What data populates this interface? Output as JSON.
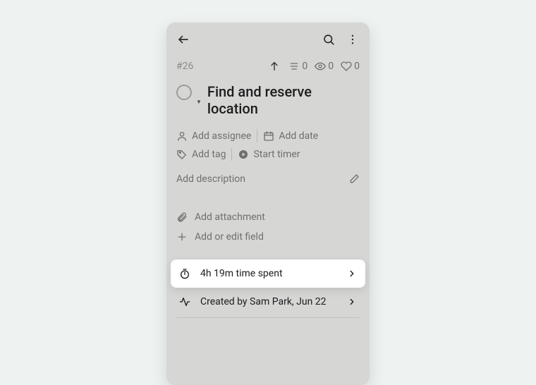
{
  "task": {
    "id": "#26",
    "title": "Find and reserve location"
  },
  "counts": {
    "comments": 0,
    "watchers": 0,
    "likes": 0
  },
  "actions": {
    "assignee": "Add assignee",
    "date": "Add date",
    "tag": "Add tag",
    "timer": "Start timer",
    "description": "Add description",
    "attachment": "Add attachment",
    "field": "Add or edit field"
  },
  "info": {
    "time_spent": "4h 19m time spent",
    "created_by": "Created by Sam Park, Jun 22"
  }
}
